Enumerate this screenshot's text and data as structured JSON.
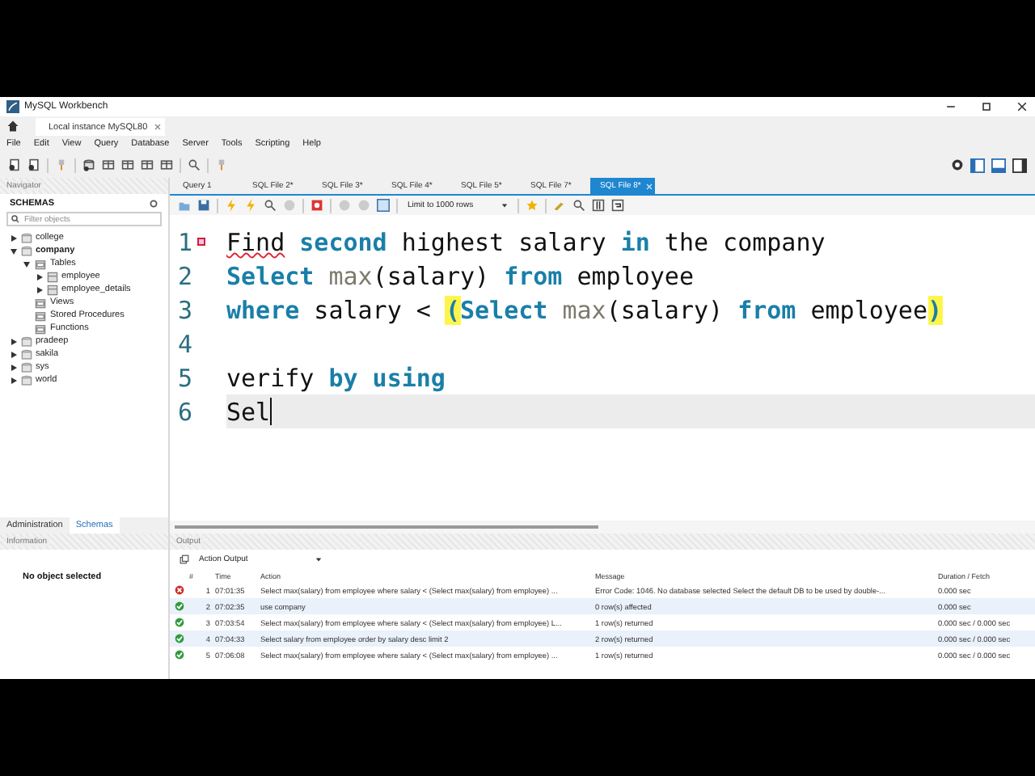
{
  "window": {
    "title": "MySQL Workbench"
  },
  "instance_tab": {
    "label": "Local instance MySQL80"
  },
  "menu": [
    "File",
    "Edit",
    "View",
    "Query",
    "Database",
    "Server",
    "Tools",
    "Scripting",
    "Help"
  ],
  "navigator": {
    "title": "Navigator",
    "section": "SCHEMAS",
    "filter_placeholder": "Filter objects",
    "tree": [
      {
        "label": "college",
        "kind": "database",
        "expanded": false,
        "default": false
      },
      {
        "label": "company",
        "kind": "database",
        "expanded": true,
        "default": true,
        "children": [
          {
            "label": "Tables",
            "kind": "folder",
            "expanded": true,
            "default": false,
            "children": [
              {
                "label": "employee",
                "kind": "table",
                "expanded": false,
                "default": false
              },
              {
                "label": "employee_details",
                "kind": "table",
                "expanded": false,
                "default": false
              }
            ]
          },
          {
            "label": "Views",
            "kind": "folder",
            "default": false
          },
          {
            "label": "Stored Procedures",
            "kind": "folder",
            "default": false
          },
          {
            "label": "Functions",
            "kind": "folder",
            "default": false
          }
        ]
      },
      {
        "label": "pradeep",
        "kind": "database",
        "expanded": false,
        "default": false
      },
      {
        "label": "sakila",
        "kind": "database",
        "expanded": false,
        "default": false
      },
      {
        "label": "sys",
        "kind": "database",
        "expanded": false,
        "default": false
      },
      {
        "label": "world",
        "kind": "database",
        "expanded": false,
        "default": false
      }
    ],
    "tabs": [
      {
        "label": "Administration",
        "selected": false
      },
      {
        "label": "Schemas",
        "selected": true
      }
    ]
  },
  "information": {
    "title": "Information",
    "message": "No object selected"
  },
  "editor": {
    "tabs": [
      {
        "label": "Query 1",
        "selected": false
      },
      {
        "label": "SQL File 2*",
        "selected": false
      },
      {
        "label": "SQL File 3*",
        "selected": false
      },
      {
        "label": "SQL File 4*",
        "selected": false
      },
      {
        "label": "SQL File 5*",
        "selected": false
      },
      {
        "label": "SQL File 7*",
        "selected": false
      },
      {
        "label": "SQL File 8*",
        "selected": true
      }
    ],
    "limit_select": "Limit to 1000 rows",
    "lines": [
      {
        "number": "1",
        "error": true,
        "current": false,
        "tokens": [
          {
            "text": "Find",
            "kind": "error"
          },
          {
            "text": " second",
            "kind": "keyword"
          },
          {
            "text": " highest salary ",
            "kind": "plain"
          },
          {
            "text": "in",
            "kind": "keyword"
          },
          {
            "text": " the company",
            "kind": "plain"
          }
        ]
      },
      {
        "number": "2",
        "error": false,
        "current": false,
        "tokens": [
          {
            "text": "Select",
            "kind": "keyword"
          },
          {
            "text": " max",
            "kind": "function"
          },
          {
            "text": "(salary) ",
            "kind": "plain"
          },
          {
            "text": "from",
            "kind": "keyword"
          },
          {
            "text": " employee",
            "kind": "plain"
          }
        ]
      },
      {
        "number": "3",
        "error": false,
        "current": false,
        "tokens": [
          {
            "text": "where",
            "kind": "keyword"
          },
          {
            "text": " salary < ",
            "kind": "plain"
          },
          {
            "text": "(",
            "kind": "match"
          },
          {
            "text": "Select",
            "kind": "keyword"
          },
          {
            "text": " max",
            "kind": "function"
          },
          {
            "text": "(salary) ",
            "kind": "plain"
          },
          {
            "text": "from",
            "kind": "keyword"
          },
          {
            "text": " employee",
            "kind": "plain"
          },
          {
            "text": ")",
            "kind": "match"
          }
        ]
      },
      {
        "number": "4",
        "error": false,
        "current": false
      },
      {
        "number": "5",
        "error": false,
        "current": false,
        "tokens": [
          {
            "text": "verify ",
            "kind": "plain"
          },
          {
            "text": "by",
            "kind": "keyword"
          },
          {
            "text": " using",
            "kind": "keyword"
          }
        ]
      },
      {
        "number": "6",
        "error": false,
        "current": true,
        "tokens": [
          {
            "text": "Sel",
            "kind": "plain"
          }
        ]
      }
    ]
  },
  "output": {
    "title": "Output",
    "view_select": "Action Output",
    "columns": [
      "#",
      "Time",
      "Action",
      "Message",
      "Duration / Fetch"
    ],
    "rows": [
      {
        "kind": "error",
        "number": "1",
        "time": "07:01:35",
        "action": "Select max(salary) from employee  where salary < (Select max(salary) from employee) ...",
        "message": "Error Code: 1046. No database selected Select the default DB to be used by double-...",
        "duration": "0.000 sec"
      },
      {
        "kind": "ok",
        "number": "2",
        "time": "07:02:35",
        "action": "use company",
        "message": "0 row(s) affected",
        "duration": "0.000 sec"
      },
      {
        "kind": "ok",
        "number": "3",
        "time": "07:03:54",
        "action": "Select max(salary) from employee where salary < (Select max(salary) from employee) L...",
        "message": "1 row(s) returned",
        "duration": "0.000 sec / 0.000 sec"
      },
      {
        "kind": "ok",
        "number": "4",
        "time": "07:04:33",
        "action": "Select salary from employee order by salary desc limit 2",
        "message": "2 row(s) returned",
        "duration": "0.000 sec / 0.000 sec"
      },
      {
        "kind": "ok",
        "number": "5",
        "time": "07:06:08",
        "action": "Select max(salary) from employee  where salary < (Select max(salary) from employee) ...",
        "message": "1 row(s) returned",
        "duration": "0.000 sec / 0.000 sec"
      }
    ]
  }
}
